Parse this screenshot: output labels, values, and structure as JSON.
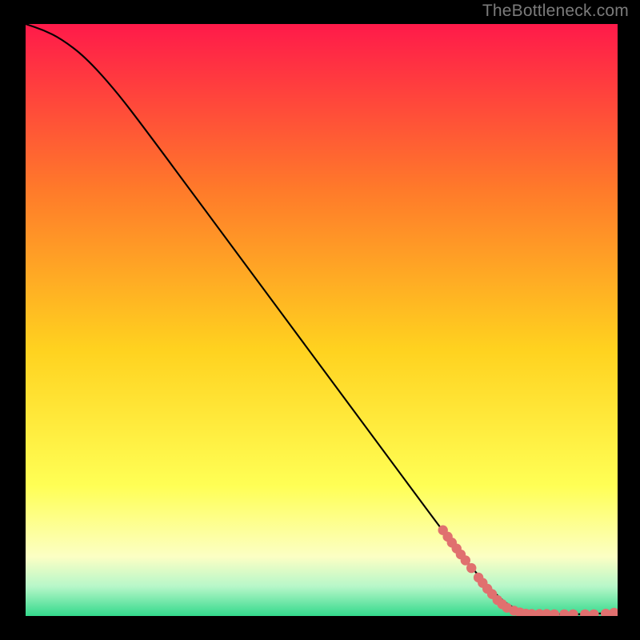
{
  "attribution": "TheBottleneck.com",
  "colors": {
    "gradient_top": "#ff1a4a",
    "gradient_mid1": "#ff7a2a",
    "gradient_mid2": "#ffd21f",
    "gradient_mid3": "#ffff55",
    "gradient_mid4": "#fcffc4",
    "gradient_bot1": "#b7f7c9",
    "gradient_bot2": "#33d98c",
    "curve": "#000000",
    "dots": "#e0706f"
  },
  "chart_data": {
    "type": "line",
    "title": "",
    "xlabel": "",
    "ylabel": "",
    "xlim": [
      0,
      100
    ],
    "ylim": [
      0,
      100
    ],
    "curve": [
      {
        "x": 0,
        "y": 100
      },
      {
        "x": 3,
        "y": 99
      },
      {
        "x": 6,
        "y": 97.5
      },
      {
        "x": 10,
        "y": 94.5
      },
      {
        "x": 15,
        "y": 89
      },
      {
        "x": 20,
        "y": 82.5
      },
      {
        "x": 30,
        "y": 69
      },
      {
        "x": 40,
        "y": 55.5
      },
      {
        "x": 50,
        "y": 42
      },
      {
        "x": 60,
        "y": 28.5
      },
      {
        "x": 70,
        "y": 15
      },
      {
        "x": 75,
        "y": 8.5
      },
      {
        "x": 80,
        "y": 3
      },
      {
        "x": 83,
        "y": 1
      },
      {
        "x": 86,
        "y": 0.4
      },
      {
        "x": 90,
        "y": 0.3
      },
      {
        "x": 95,
        "y": 0.3
      },
      {
        "x": 100,
        "y": 0.6
      }
    ],
    "dots": [
      {
        "x": 70.5,
        "y": 14.5
      },
      {
        "x": 71.3,
        "y": 13.4
      },
      {
        "x": 72.0,
        "y": 12.4
      },
      {
        "x": 72.8,
        "y": 11.4
      },
      {
        "x": 73.5,
        "y": 10.4
      },
      {
        "x": 74.3,
        "y": 9.4
      },
      {
        "x": 75.3,
        "y": 8.1
      },
      {
        "x": 76.5,
        "y": 6.5
      },
      {
        "x": 77.2,
        "y": 5.6
      },
      {
        "x": 78.0,
        "y": 4.6
      },
      {
        "x": 78.8,
        "y": 3.7
      },
      {
        "x": 79.7,
        "y": 2.7
      },
      {
        "x": 80.5,
        "y": 2.0
      },
      {
        "x": 81.3,
        "y": 1.4
      },
      {
        "x": 82.5,
        "y": 0.9
      },
      {
        "x": 83.5,
        "y": 0.6
      },
      {
        "x": 84.5,
        "y": 0.4
      },
      {
        "x": 85.5,
        "y": 0.35
      },
      {
        "x": 86.8,
        "y": 0.35
      },
      {
        "x": 88.0,
        "y": 0.35
      },
      {
        "x": 89.3,
        "y": 0.3
      },
      {
        "x": 91.0,
        "y": 0.3
      },
      {
        "x": 92.5,
        "y": 0.3
      },
      {
        "x": 94.5,
        "y": 0.3
      },
      {
        "x": 96.0,
        "y": 0.3
      },
      {
        "x": 98.0,
        "y": 0.4
      },
      {
        "x": 99.4,
        "y": 0.55
      }
    ]
  }
}
